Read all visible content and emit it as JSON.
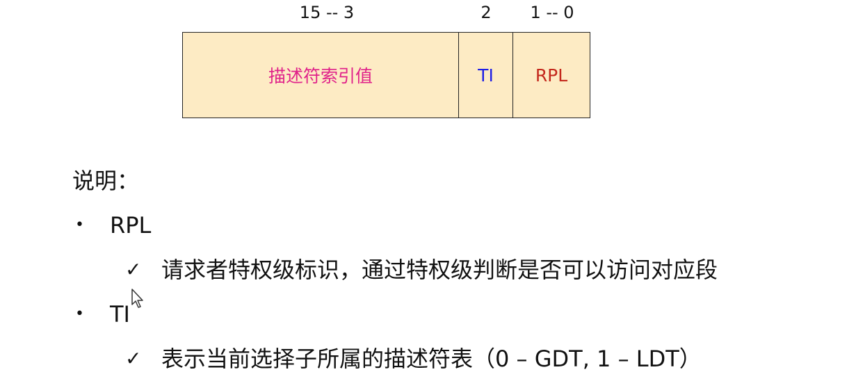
{
  "register": {
    "bit_labels": {
      "index_bits": "15 -- 3",
      "ti_bit": "2",
      "rpl_bits": "1 -- 0"
    },
    "fields": {
      "index": {
        "label": "描述符索引值",
        "color": "#e0218a"
      },
      "ti": {
        "label": "TI",
        "color": "#1f1fe6"
      },
      "rpl": {
        "label": "RPL",
        "color": "#c4281c"
      }
    },
    "fill_color": "#fdebc4"
  },
  "explanation": {
    "heading": "说明：",
    "items": [
      {
        "bullet": "•",
        "term": "RPL",
        "check": "✓",
        "detail": "请求者特权级标识，通过特权级判断是否可以访问对应段"
      },
      {
        "bullet": "•",
        "term": "TI",
        "check": "✓",
        "detail": "表示当前选择子所属的描述符表（0 – GDT, 1 – LDT）"
      }
    ]
  },
  "icons": {
    "cursor": "mouse-pointer-icon"
  }
}
